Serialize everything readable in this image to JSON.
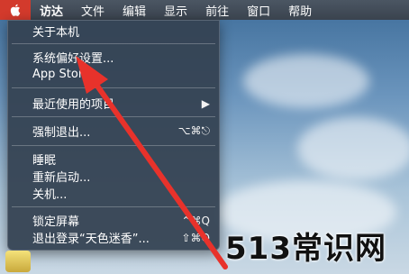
{
  "menubar": {
    "items": [
      "访达",
      "文件",
      "编辑",
      "显示",
      "前往",
      "窗口",
      "帮助"
    ]
  },
  "apple_menu": {
    "about": "关于本机",
    "preferences": "系统偏好设置...",
    "app_store": "App Store...",
    "recent_items": "最近使用的项目",
    "force_quit": "强制退出...",
    "force_quit_shortcut": "⌥⌘⎋",
    "sleep": "睡眠",
    "restart": "重新启动...",
    "shutdown": "关机...",
    "lock_screen": "锁定屏幕",
    "lock_shortcut": "⌃⌘Q",
    "logout": "退出登录“天色迷香”...",
    "logout_shortcut": "⇧⌘Q"
  },
  "watermark": "513常识网",
  "colors": {
    "apple_highlight": "#d33a2c",
    "arrow": "#e8322b"
  }
}
